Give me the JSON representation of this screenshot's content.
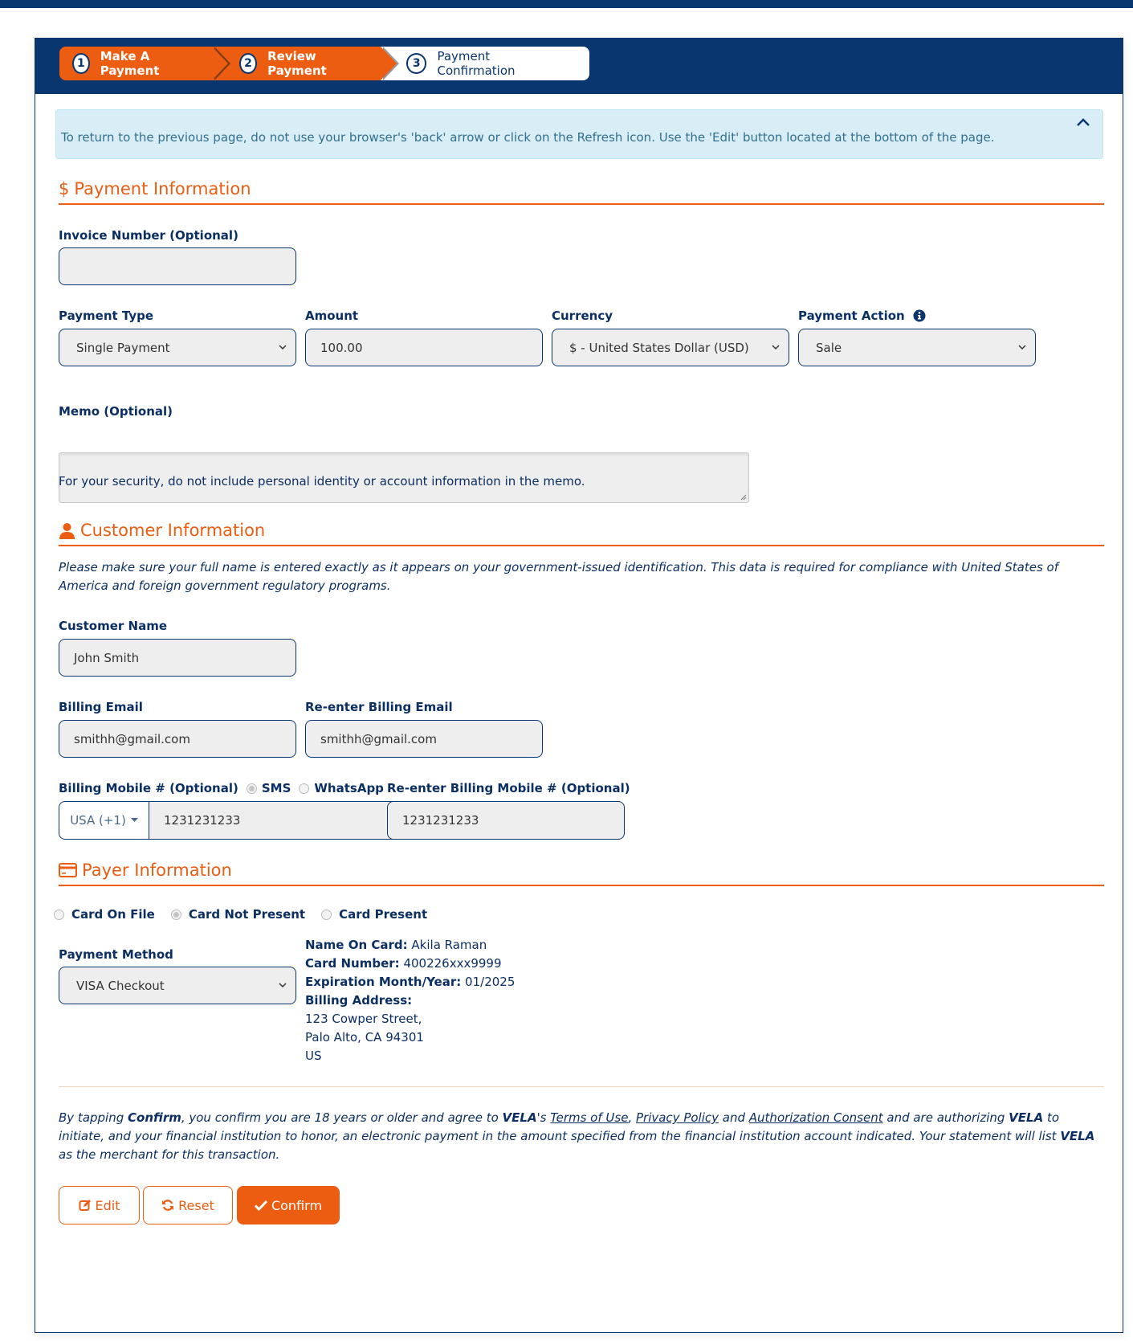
{
  "stepper": {
    "steps": [
      {
        "number": "1",
        "label": "Make A Payment",
        "state": "done"
      },
      {
        "number": "2",
        "label": "Review Payment",
        "state": "done"
      },
      {
        "number": "3",
        "label": "Payment Confirmation",
        "state": "current"
      }
    ]
  },
  "alert": {
    "text": "To return to the previous page, do not use your browser's 'back' arrow or click on the Refresh icon. Use the 'Edit' button located at the bottom of the page.",
    "collapse_icon": "chevron-up-icon"
  },
  "payment_info": {
    "title": "Payment Information",
    "icon": "dollar-icon",
    "icon_glyph": "$",
    "invoice": {
      "label": "Invoice Number (Optional)",
      "value": ""
    },
    "payment_type": {
      "label": "Payment Type",
      "value": "Single Payment"
    },
    "amount": {
      "label": "Amount",
      "value": "100.00"
    },
    "currency": {
      "label": "Currency",
      "value": "$ - United States Dollar (USD)"
    },
    "payment_action": {
      "label": "Payment Action",
      "value": "Sale",
      "info_icon": "info-circle-icon"
    },
    "memo": {
      "label": "Memo (Optional)",
      "value": "",
      "help": "For your security, do not include personal identity or account information in the memo."
    }
  },
  "customer_info": {
    "title": "Customer Information",
    "icon": "user-icon",
    "notice": "Please make sure your full name is entered exactly as it appears on your government-issued identification. This data is required for compliance with United States of America and foreign government regulatory programs.",
    "customer_name": {
      "label": "Customer Name",
      "value": "John Smith"
    },
    "billing_email": {
      "label": "Billing Email",
      "value": "smithh@gmail.com"
    },
    "reenter_email": {
      "label": "Re-enter Billing Email",
      "value": "smithh@gmail.com"
    },
    "billing_mobile": {
      "label": "Billing Mobile # (Optional)",
      "channels": [
        {
          "label": "SMS",
          "selected": true
        },
        {
          "label": "WhatsApp",
          "selected": false
        }
      ],
      "country_code": "USA (+1)",
      "value": "1231231233"
    },
    "reenter_mobile": {
      "label": "Re-enter Billing Mobile # (Optional)",
      "value": "1231231233"
    }
  },
  "payer_info": {
    "title": "Payer Information",
    "icon": "credit-card-icon",
    "card_modes": [
      {
        "label": "Card On File",
        "selected": false
      },
      {
        "label": "Card Not Present",
        "selected": true
      },
      {
        "label": "Card Present",
        "selected": false
      }
    ],
    "payment_method": {
      "label": "Payment Method",
      "value": "VISA Checkout"
    },
    "card": {
      "name_label": "Name On Card:",
      "name_value": "Akila Raman",
      "number_label": "Card Number:",
      "number_value": "400226xxx9999",
      "exp_label": "Expiration Month/Year:",
      "exp_value": "01/2025",
      "address_label": "Billing Address:",
      "address_line1": "123 Cowper Street,",
      "address_line2": "Palo Alto, CA 94301",
      "address_line3": "US"
    }
  },
  "consent": {
    "p1": "By tapping ",
    "confirm_word": "Confirm",
    "p2": ", you confirm you are 18 years or older and agree to ",
    "vela1": "VELA",
    "p3": "'s ",
    "terms": "Terms of Use",
    "p4": ", ",
    "privacy": "Privacy Policy",
    "p5": " and ",
    "auth": "Authorization Consent",
    "p6": " and are authorizing ",
    "vela2": "VELA",
    "p7": " to initiate, and your financial institution to honor, an electronic payment in the amount specified from the financial institution account indicated. Your statement will list ",
    "vela3": "VELA",
    "p8": " as the merchant for this transaction."
  },
  "actions": {
    "edit": "Edit",
    "reset": "Reset",
    "confirm": "Confirm"
  },
  "colors": {
    "brand_navy": "#0a3670",
    "accent_orange": "#ec5d12",
    "alert_bg": "#d9edf7",
    "alert_text": "#31708f"
  }
}
